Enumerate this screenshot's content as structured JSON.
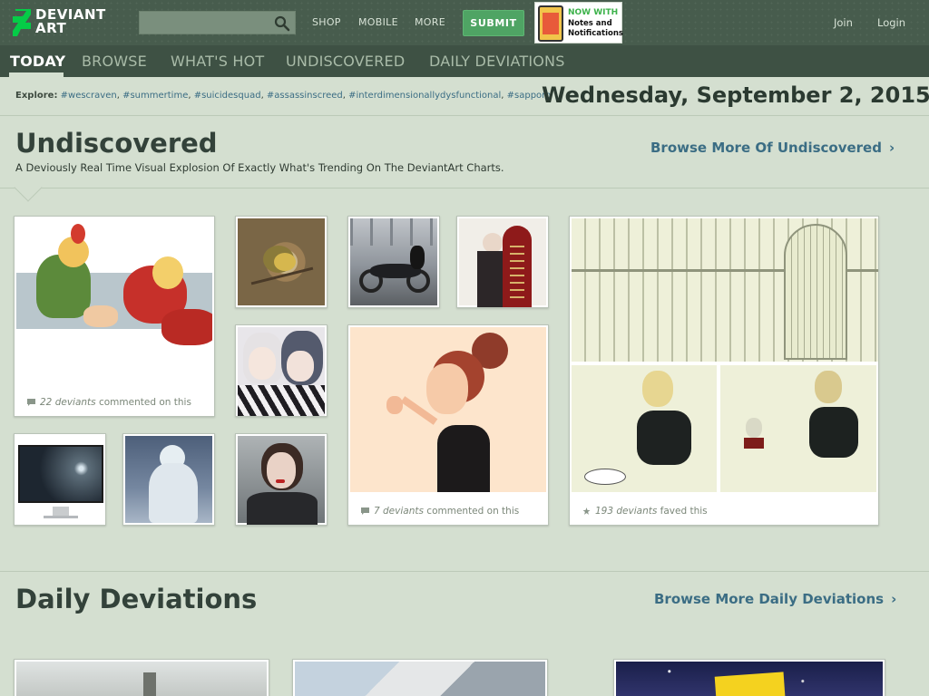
{
  "header": {
    "logo": {
      "line1": "DEVIANT",
      "line2": "ART"
    },
    "search": {
      "placeholder": ""
    },
    "nav": [
      "SHOP",
      "MOBILE",
      "MORE"
    ],
    "submit_label": "SUBMIT",
    "promo": {
      "title": "NOW WITH",
      "subtitle": "Notes and Notifications"
    },
    "join_label": "Join",
    "login_label": "Login"
  },
  "tabs": [
    {
      "label": "TODAY",
      "active": true
    },
    {
      "label": "BROWSE",
      "active": false
    },
    {
      "label": "WHAT'S HOT",
      "active": false
    },
    {
      "label": "UNDISCOVERED",
      "active": false
    },
    {
      "label": "DAILY DEVIATIONS",
      "active": false
    }
  ],
  "explore": {
    "label": "Explore:",
    "tags": [
      "#wescraven",
      "#summertime",
      "#suicidesquad",
      "#assassinscreed",
      "#interdimensionallydysfunctional",
      "#sapporo"
    ]
  },
  "date": "Wednesday, September 2, 2015",
  "undiscovered": {
    "title": "Undiscovered",
    "subtitle": "A Deviously Real Time Visual Explosion Of Exactly What's Trending On The DeviantArt Charts.",
    "browse_label": "Browse More Of Undiscovered",
    "cards": [
      {
        "count": "22 deviants",
        "action": "commented on this",
        "icon": "comment-icon"
      },
      {
        "count": "7 deviants",
        "action": "commented on this",
        "icon": "comment-icon"
      },
      {
        "count": "193 deviants",
        "action": "faved this",
        "icon": "star-icon"
      }
    ]
  },
  "daily": {
    "title": "Daily Deviations",
    "browse_label": "Browse More Daily Deviations"
  },
  "colors": {
    "page_bg": "#d4dfd0",
    "header_bg": "#475c4d",
    "tab_bg": "#3e5144",
    "accent_link": "#3b6d84",
    "submit_green": "#4fa464",
    "logo_green": "#05cc47"
  }
}
